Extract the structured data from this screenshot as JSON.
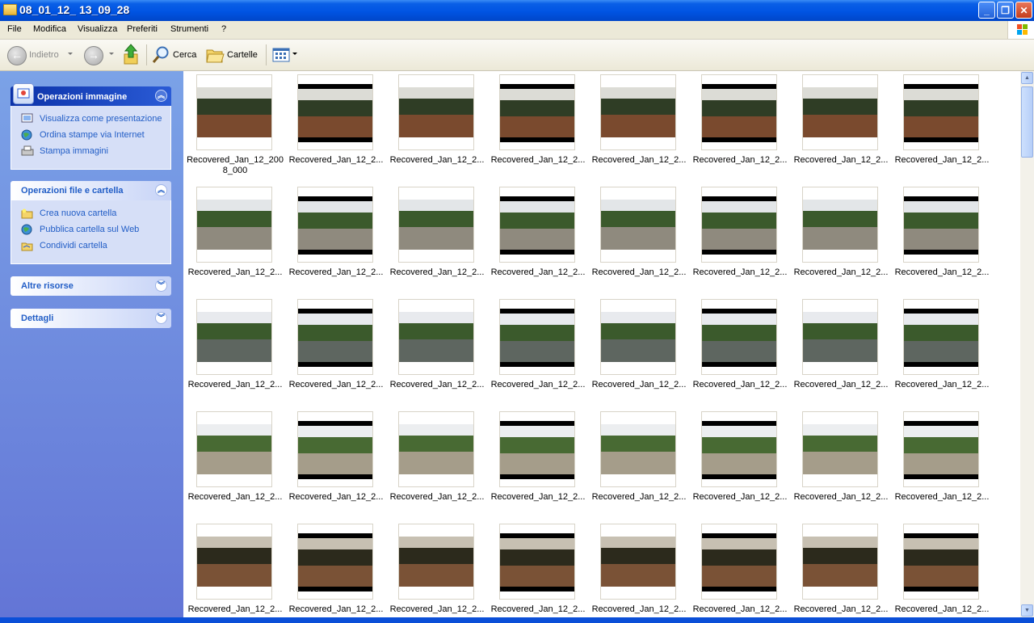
{
  "window": {
    "title": "08_01_12_ 13_09_28"
  },
  "menu": [
    "File",
    "Modifica",
    "Visualizza",
    "Preferiti",
    "Strumenti",
    "?"
  ],
  "toolbar": {
    "back_label": "Indietro",
    "search_label": "Cerca",
    "folders_label": "Cartelle"
  },
  "left_panel": {
    "image_tasks": {
      "title": "Operazioni immagine",
      "items": [
        "Visualizza come presentazione",
        "Ordina stampe via Internet",
        "Stampa immagini"
      ]
    },
    "file_tasks": {
      "title": "Operazioni file e cartella",
      "items": [
        "Crea nuova cartella",
        "Pubblica cartella sul Web",
        "Condividi cartella"
      ]
    },
    "other_places": {
      "title": "Altre risorse"
    },
    "details": {
      "title": "Dettagli"
    }
  },
  "files": [
    "Recovered_Jan_12_2008_000",
    "Recovered_Jan_12_2...",
    "Recovered_Jan_12_2...",
    "Recovered_Jan_12_2...",
    "Recovered_Jan_12_2...",
    "Recovered_Jan_12_2...",
    "Recovered_Jan_12_2...",
    "Recovered_Jan_12_2...",
    "Recovered_Jan_12_2...",
    "Recovered_Jan_12_2...",
    "Recovered_Jan_12_2...",
    "Recovered_Jan_12_2...",
    "Recovered_Jan_12_2...",
    "Recovered_Jan_12_2...",
    "Recovered_Jan_12_2...",
    "Recovered_Jan_12_2...",
    "Recovered_Jan_12_2...",
    "Recovered_Jan_12_2...",
    "Recovered_Jan_12_2...",
    "Recovered_Jan_12_2...",
    "Recovered_Jan_12_2...",
    "Recovered_Jan_12_2...",
    "Recovered_Jan_12_2...",
    "Recovered_Jan_12_2...",
    "Recovered_Jan_12_2...",
    "Recovered_Jan_12_2...",
    "Recovered_Jan_12_2...",
    "Recovered_Jan_12_2...",
    "Recovered_Jan_12_2...",
    "Recovered_Jan_12_2...",
    "Recovered_Jan_12_2...",
    "Recovered_Jan_12_2...",
    "Recovered_Jan_12_2...",
    "Recovered_Jan_12_2...",
    "Recovered_Jan_12_2...",
    "Recovered_Jan_12_2...",
    "Recovered_Jan_12_2...",
    "Recovered_Jan_12_2...",
    "Recovered_Jan_12_2...",
    "Recovered_Jan_12_2..."
  ],
  "colors": {
    "title_bar": "#0054e3",
    "task_pane": "#7ba2e7",
    "link": "#215dc6"
  }
}
